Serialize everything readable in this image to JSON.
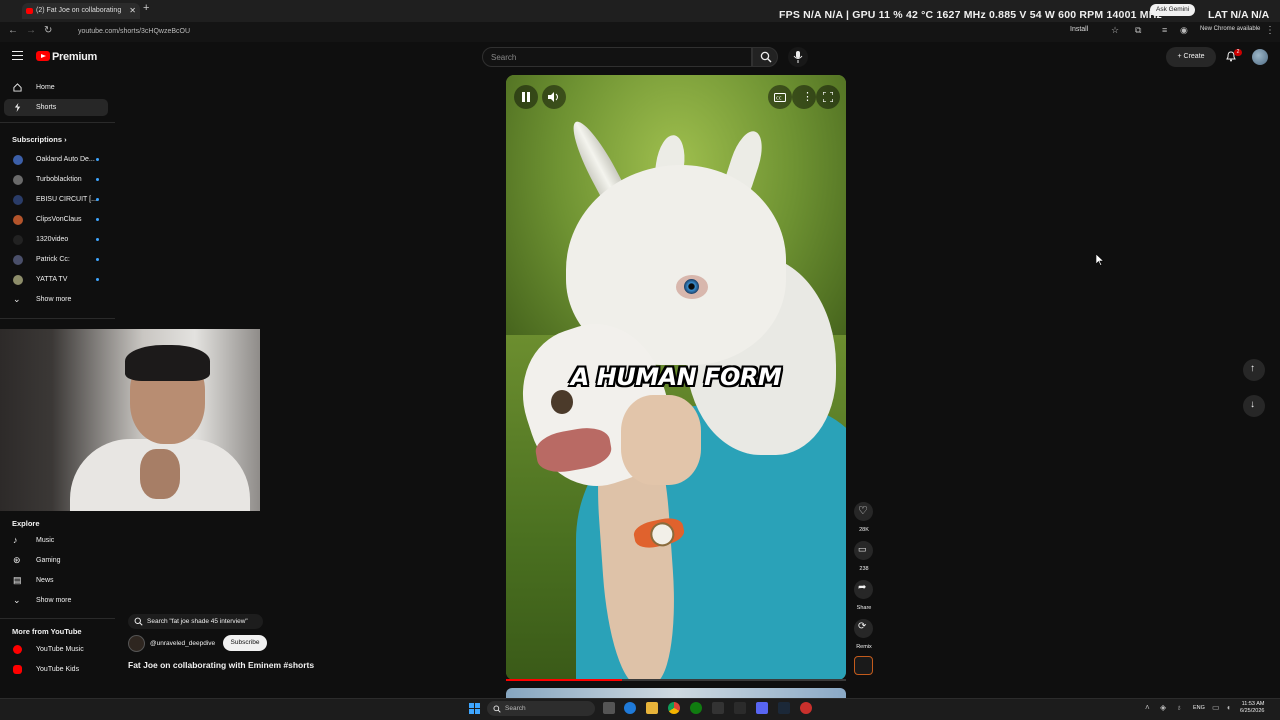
{
  "browser": {
    "tab_title": "(2) Fat Joe on collaborating",
    "url": "youtube.com/shorts/3cHQwzeBcOU",
    "install_label": "Install",
    "ask_gemini_label": "Ask Gemini",
    "new_chrome_label": "New Chrome available"
  },
  "overlay": {
    "stats": "FPS  N/A  N/A  |  GPU  11 %  42 °C  1627 MHz  0.885 V  54 W  600 RPM  14001 MHz",
    "lat": "LAT  N/A  N/A"
  },
  "header": {
    "logo_text": "Premium",
    "search_placeholder": "Search",
    "create_label": "Create",
    "notification_count": "2"
  },
  "sidebar": {
    "home_label": "Home",
    "shorts_label": "Shorts",
    "subscriptions_heading": "Subscriptions",
    "subscriptions": [
      {
        "name": "Oakland Auto De...",
        "color": "#3c5fa8"
      },
      {
        "name": "Turboblacktion",
        "color": "#6a6a6a"
      },
      {
        "name": "EBISU CIRCUIT [...",
        "color": "#2a3c68"
      },
      {
        "name": "ClipsVonClaus",
        "color": "#b3542b"
      },
      {
        "name": "1320video",
        "color": "#222222"
      },
      {
        "name": "Patrick Cc:",
        "color": "#4a4f6a"
      },
      {
        "name": "YATTA TV",
        "color": "#8d8d6a"
      }
    ],
    "show_more_label": "Show more",
    "explore_heading": "Explore",
    "explore_items": [
      "Music",
      "Gaming",
      "News"
    ],
    "explore_show_more": "Show more",
    "more_heading": "More from YouTube",
    "more_items": [
      "YouTube Music",
      "YouTube Kids"
    ]
  },
  "short": {
    "related_search": "Search \"fat joe shade 45 interview\"",
    "channel": "@unraveled_deepdive",
    "subscribe_label": "Subscribe",
    "title": "Fat Joe on collaborating with Eminem #shorts",
    "caption": "A HUMAN FORM",
    "progress": 0.34,
    "likes": "28K",
    "comments": "238",
    "share_label": "Share",
    "remix_label": "Remix"
  },
  "taskbar": {
    "search_placeholder": "Search",
    "language": "ENG",
    "time": "11:53 AM",
    "date": "6/25/2026"
  }
}
